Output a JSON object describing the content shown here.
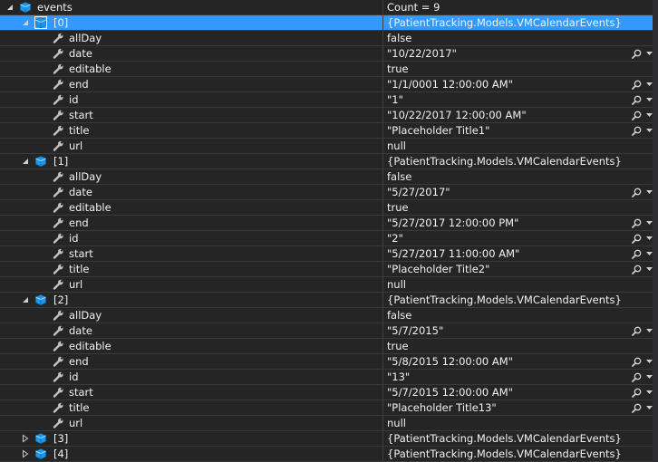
{
  "colors": {
    "background": "#252526",
    "selected_row": "#3399ff",
    "text": "#f1f1f1",
    "icon_object": "#4aa5e6",
    "icon_property": "#bdbdbd"
  },
  "root": {
    "name": "events",
    "value": "Count = 9"
  },
  "items": [
    {
      "name": "[0]",
      "value": "{PatientTracking.Models.VMCalendarEvents}",
      "expanded": true,
      "selected": true,
      "props": [
        {
          "name": "allDay",
          "value": "false",
          "viewer": false
        },
        {
          "name": "date",
          "value": "\"10/22/2017\"",
          "viewer": true
        },
        {
          "name": "editable",
          "value": "true",
          "viewer": false
        },
        {
          "name": "end",
          "value": "\"1/1/0001 12:00:00 AM\"",
          "viewer": true
        },
        {
          "name": "id",
          "value": "\"1\"",
          "viewer": true
        },
        {
          "name": "start",
          "value": "\"10/22/2017 12:00:00 AM\"",
          "viewer": true
        },
        {
          "name": "title",
          "value": "\"Placeholder Title1\"",
          "viewer": true
        },
        {
          "name": "url",
          "value": "null",
          "viewer": false
        }
      ]
    },
    {
      "name": "[1]",
      "value": "{PatientTracking.Models.VMCalendarEvents}",
      "expanded": true,
      "selected": false,
      "props": [
        {
          "name": "allDay",
          "value": "false",
          "viewer": false
        },
        {
          "name": "date",
          "value": "\"5/27/2017\"",
          "viewer": true
        },
        {
          "name": "editable",
          "value": "true",
          "viewer": false
        },
        {
          "name": "end",
          "value": "\"5/27/2017 12:00:00 PM\"",
          "viewer": true
        },
        {
          "name": "id",
          "value": "\"2\"",
          "viewer": true
        },
        {
          "name": "start",
          "value": "\"5/27/2017 11:00:00 AM\"",
          "viewer": true
        },
        {
          "name": "title",
          "value": "\"Placeholder Title2\"",
          "viewer": true
        },
        {
          "name": "url",
          "value": "null",
          "viewer": false
        }
      ]
    },
    {
      "name": "[2]",
      "value": "{PatientTracking.Models.VMCalendarEvents}",
      "expanded": true,
      "selected": false,
      "props": [
        {
          "name": "allDay",
          "value": "false",
          "viewer": false
        },
        {
          "name": "date",
          "value": "\"5/7/2015\"",
          "viewer": true
        },
        {
          "name": "editable",
          "value": "true",
          "viewer": false
        },
        {
          "name": "end",
          "value": "\"5/8/2015 12:00:00 AM\"",
          "viewer": true
        },
        {
          "name": "id",
          "value": "\"13\"",
          "viewer": true
        },
        {
          "name": "start",
          "value": "\"5/7/2015 12:00:00 AM\"",
          "viewer": true
        },
        {
          "name": "title",
          "value": "\"Placeholder Title13\"",
          "viewer": true
        },
        {
          "name": "url",
          "value": "null",
          "viewer": false
        }
      ]
    },
    {
      "name": "[3]",
      "value": "{PatientTracking.Models.VMCalendarEvents}",
      "expanded": false,
      "selected": false,
      "props": []
    },
    {
      "name": "[4]",
      "value": "{PatientTracking.Models.VMCalendarEvents}",
      "expanded": false,
      "selected": false,
      "props": []
    }
  ],
  "icons": {
    "expanded": "expanded-triangle-icon",
    "collapsed": "collapsed-triangle-icon",
    "object": "object-cube-icon",
    "property": "wrench-property-icon",
    "viewer": "magnifier-icon",
    "dropdown": "dropdown-arrow-icon"
  }
}
